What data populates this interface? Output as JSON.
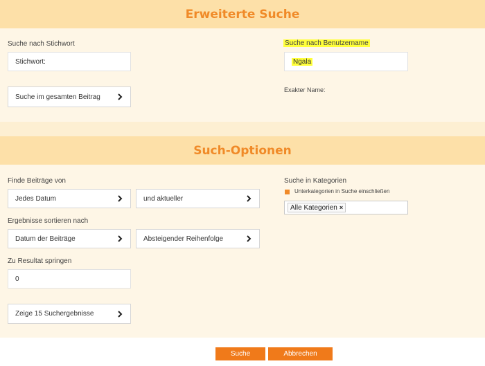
{
  "header": {
    "title": "Erweiterte Suche"
  },
  "keyword": {
    "label": "Suche nach Stichwort",
    "value": "Stichwort:",
    "scope_select": "Suche im gesamten Beitrag"
  },
  "username": {
    "label": "Suche nach Benutzername",
    "value": "Ngala",
    "exact_label": "Exakter Name:"
  },
  "options": {
    "title": "Such-Optionen",
    "find_label": "Finde Beiträge von",
    "date_select": "Jedes Datum",
    "date_dir_select": "und aktueller",
    "sort_label": "Ergebnisse sortieren nach",
    "sort_select": "Datum der Beiträge",
    "order_select": "Absteigender Reihenfolge",
    "jump_label": "Zu Resultat springen",
    "jump_value": "0",
    "results_select": "Zeige 15 Suchergebnisse",
    "categories_label": "Suche in Kategorien",
    "subcategories_label": "Unterkategorien in Suche einschließen",
    "category_tag": "Alle Kategorien",
    "tag_remove": "×"
  },
  "actions": {
    "search": "Suche",
    "cancel": "Abbrechen"
  },
  "colors": {
    "accent": "#f08a28",
    "header_bg": "#fde0a8",
    "panel_bg": "#fef6e6",
    "highlight": "#ffff3a"
  }
}
